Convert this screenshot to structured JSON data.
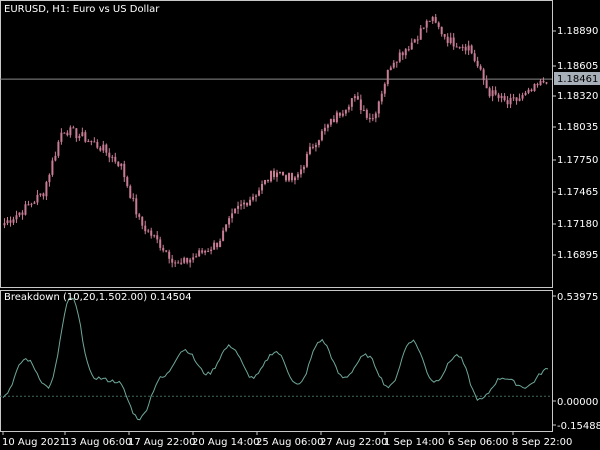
{
  "symbol_header": "EURUSD, H1:  Euro vs US Dollar",
  "price_axis": {
    "ticks": [
      "1.18890",
      "1.18605",
      "1.18320",
      "1.18035",
      "1.17750",
      "1.17465",
      "1.17180",
      "1.16895"
    ],
    "current_label": "1.18461"
  },
  "indicator": {
    "header": "Breakdown (10,20,1.502.00) 0.14504",
    "ticks": [
      "0.53975",
      "0.00000",
      "-0.15488"
    ]
  },
  "time_axis": {
    "ticks": [
      "10 Aug 2021",
      "13 Aug 06:00",
      "17 Aug 22:00",
      "20 Aug 14:00",
      "25 Aug 06:00",
      "27 Aug 22:00",
      "1 Sep 14:00",
      "6 Sep 06:00",
      "8 Sep 22:00"
    ]
  },
  "colors": {
    "background": "#000000",
    "frame": "#c8c8c8",
    "candles": "#c87d95",
    "indicator_line": "#6fa89a",
    "zero_line": "#3f6b5f",
    "current_price_line": "#8a8a8a",
    "current_price_box": "#a7b0b8"
  },
  "chart_data": [
    {
      "type": "candlestick",
      "title": "EURUSD, H1:  Euro vs US Dollar",
      "x_range": [
        "10 Aug 2021",
        "9 Sep 2021"
      ],
      "ylim": [
        1.1675,
        1.1915
      ],
      "current_price": 1.18461,
      "close_path": [
        {
          "x": "10 Aug 2021",
          "close": 1.1718
        },
        {
          "x": "11 Aug",
          "close": 1.173
        },
        {
          "x": "12 Aug",
          "close": 1.1745
        },
        {
          "x": "13 Aug 06:00",
          "close": 1.1802
        },
        {
          "x": "14 Aug",
          "close": 1.1795
        },
        {
          "x": "15 Aug",
          "close": 1.1785
        },
        {
          "x": "16 Aug",
          "close": 1.177
        },
        {
          "x": "17 Aug",
          "close": 1.1718
        },
        {
          "x": "17 Aug 22:00",
          "close": 1.17
        },
        {
          "x": "18 Aug",
          "close": 1.168
        },
        {
          "x": "19 Aug",
          "close": 1.169
        },
        {
          "x": "20 Aug 14:00",
          "close": 1.17
        },
        {
          "x": "21 Aug",
          "close": 1.173
        },
        {
          "x": "23 Aug",
          "close": 1.1745
        },
        {
          "x": "25 Aug 06:00",
          "close": 1.1765
        },
        {
          "x": "26 Aug",
          "close": 1.1755
        },
        {
          "x": "27 Aug",
          "close": 1.179
        },
        {
          "x": "27 Aug 22:00",
          "close": 1.181
        },
        {
          "x": "30 Aug",
          "close": 1.183
        },
        {
          "x": "31 Aug",
          "close": 1.181
        },
        {
          "x": "1 Sep 14:00",
          "close": 1.1862
        },
        {
          "x": "2 Sep",
          "close": 1.1878
        },
        {
          "x": "3 Sep",
          "close": 1.19
        },
        {
          "x": "4 Sep",
          "close": 1.188
        },
        {
          "x": "6 Sep 06:00",
          "close": 1.1875
        },
        {
          "x": "7 Sep",
          "close": 1.1835
        },
        {
          "x": "8 Sep",
          "close": 1.1824
        },
        {
          "x": "8 Sep 22:00",
          "close": 1.1832
        },
        {
          "x": "9 Sep",
          "close": 1.1846
        }
      ]
    },
    {
      "type": "line",
      "title": "Breakdown (10,20,1.502.00) 0.14504",
      "ylim": [
        -0.15488,
        0.53975
      ],
      "reference_line": 0.0,
      "last_value": 0.14504,
      "approx_points": [
        {
          "x": "10 Aug 2021",
          "y": 0.0
        },
        {
          "x": "11 Aug",
          "y": 0.2
        },
        {
          "x": "12 Aug",
          "y": 0.05
        },
        {
          "x": "13 Aug 06:00",
          "y": 0.53
        },
        {
          "x": "14 Aug",
          "y": 0.1
        },
        {
          "x": "16 Aug",
          "y": 0.08
        },
        {
          "x": "17 Aug 22:00",
          "y": -0.12
        },
        {
          "x": "18 Aug",
          "y": 0.1
        },
        {
          "x": "19 Aug",
          "y": 0.25
        },
        {
          "x": "20 Aug 14:00",
          "y": 0.12
        },
        {
          "x": "21 Aug",
          "y": 0.27
        },
        {
          "x": "23 Aug",
          "y": 0.1
        },
        {
          "x": "25 Aug 06:00",
          "y": 0.24
        },
        {
          "x": "26 Aug",
          "y": 0.06
        },
        {
          "x": "27 Aug",
          "y": 0.3
        },
        {
          "x": "27 Aug 22:00",
          "y": 0.1
        },
        {
          "x": "30 Aug",
          "y": 0.22
        },
        {
          "x": "31 Aug",
          "y": 0.05
        },
        {
          "x": "1 Sep 14:00",
          "y": 0.3
        },
        {
          "x": "2 Sep",
          "y": 0.08
        },
        {
          "x": "3 Sep",
          "y": 0.22
        },
        {
          "x": "6 Sep 06:00",
          "y": -0.02
        },
        {
          "x": "7 Sep",
          "y": 0.1
        },
        {
          "x": "8 Sep 22:00",
          "y": 0.05
        },
        {
          "x": "9 Sep",
          "y": 0.14504
        }
      ]
    }
  ]
}
